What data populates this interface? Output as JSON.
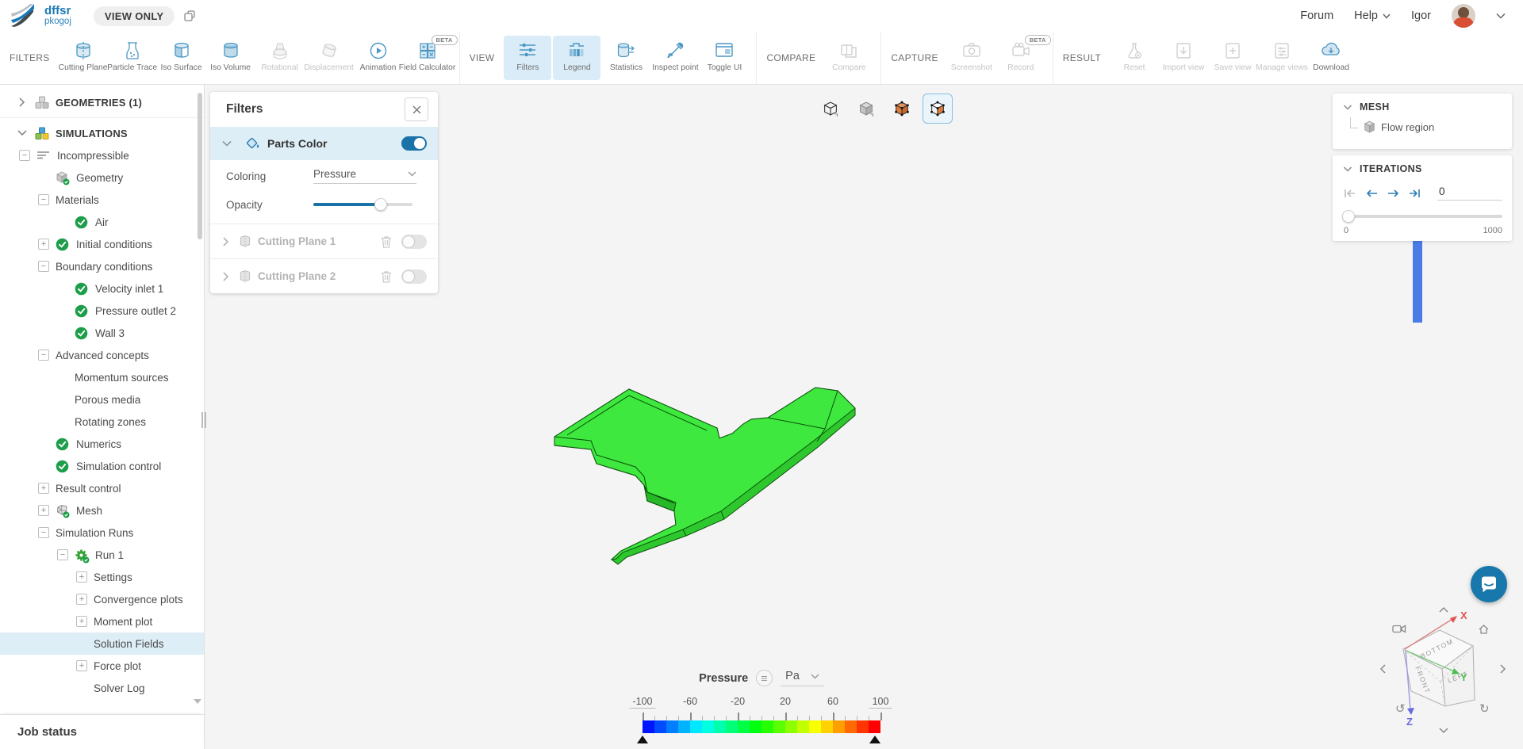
{
  "header": {
    "app_title": "dffsr",
    "app_subtitle": "pkogoj",
    "badge": "VIEW ONLY",
    "forum": "Forum",
    "help": "Help",
    "user": "Igor"
  },
  "toolbar": {
    "sections": [
      {
        "label": "FILTERS",
        "items": [
          {
            "label": "Cutting Plane",
            "icon": "cutting-plane",
            "state": "normal"
          },
          {
            "label": "Particle Trace",
            "icon": "particle-trace",
            "state": "normal"
          },
          {
            "label": "Iso Surface",
            "icon": "iso-surface",
            "state": "normal"
          },
          {
            "label": "Iso Volume",
            "icon": "iso-volume",
            "state": "normal"
          },
          {
            "label": "Rotational",
            "icon": "rotational",
            "state": "disabled"
          },
          {
            "label": "Displacement",
            "icon": "displacement",
            "state": "disabled"
          },
          {
            "label": "Animation",
            "icon": "animation",
            "state": "normal"
          },
          {
            "label": "Field Calculator",
            "icon": "field-calculator",
            "state": "normal",
            "beta": true
          }
        ]
      },
      {
        "label": "VIEW",
        "items": [
          {
            "label": "Filters",
            "icon": "filters",
            "state": "active"
          },
          {
            "label": "Legend",
            "icon": "legend",
            "state": "active"
          },
          {
            "label": "Statistics",
            "icon": "statistics",
            "state": "normal"
          },
          {
            "label": "Inspect point",
            "icon": "inspect-point",
            "state": "normal"
          },
          {
            "label": "Toggle UI",
            "icon": "toggle-ui",
            "state": "normal"
          }
        ]
      },
      {
        "label": "COMPARE",
        "items": [
          {
            "label": "Compare",
            "icon": "compare",
            "state": "disabled"
          }
        ]
      },
      {
        "label": "CAPTURE",
        "items": [
          {
            "label": "Screenshot",
            "icon": "screenshot",
            "state": "disabled"
          },
          {
            "label": "Record",
            "icon": "record",
            "state": "disabled",
            "beta": true
          }
        ]
      },
      {
        "label": "RESULT",
        "items": [
          {
            "label": "Reset",
            "icon": "reset",
            "state": "disabled"
          },
          {
            "label": "Import view",
            "icon": "import-view",
            "state": "disabled"
          },
          {
            "label": "Save view",
            "icon": "save-view",
            "state": "disabled"
          },
          {
            "label": "Manage views",
            "icon": "manage-views",
            "state": "disabled"
          },
          {
            "label": "Download",
            "icon": "download",
            "state": "normal"
          }
        ]
      }
    ]
  },
  "tree": {
    "items": [
      {
        "label": "GEOMETRIES (1)",
        "level": 0,
        "expander": "chevron-right",
        "icon": "cubes-gray",
        "header": true,
        "divider_after": true
      },
      {
        "label": "SIMULATIONS",
        "level": 0,
        "expander": "chevron-down",
        "icon": "cubes-color",
        "header": true
      },
      {
        "label": "Incompressible",
        "level": 1,
        "expander": "minus",
        "icon": "list"
      },
      {
        "label": "Geometry",
        "level": 2,
        "icon": "geometry-check"
      },
      {
        "label": "Materials",
        "level": 2,
        "expander": "minus"
      },
      {
        "label": "Air",
        "level": 3,
        "icon": "check"
      },
      {
        "label": "Initial conditions",
        "level": 2,
        "expander": "plus",
        "icon": "check"
      },
      {
        "label": "Boundary conditions",
        "level": 2,
        "expander": "minus"
      },
      {
        "label": "Velocity inlet 1",
        "level": 3,
        "icon": "check"
      },
      {
        "label": "Pressure outlet 2",
        "level": 3,
        "icon": "check"
      },
      {
        "label": "Wall 3",
        "level": 3,
        "icon": "check"
      },
      {
        "label": "Advanced concepts",
        "level": 2,
        "expander": "minus"
      },
      {
        "label": "Momentum sources",
        "level": 3
      },
      {
        "label": "Porous media",
        "level": 3
      },
      {
        "label": "Rotating zones",
        "level": 3
      },
      {
        "label": "Numerics",
        "level": 2,
        "icon": "check"
      },
      {
        "label": "Simulation control",
        "level": 2,
        "icon": "check"
      },
      {
        "label": "Result control",
        "level": 2,
        "expander": "plus"
      },
      {
        "label": "Mesh",
        "level": 2,
        "expander": "plus",
        "icon": "mesh-check"
      },
      {
        "label": "Simulation Runs",
        "level": 2,
        "expander": "minus"
      },
      {
        "label": "Run 1",
        "level": 3,
        "expander": "minus",
        "icon": "gear-check"
      },
      {
        "label": "Settings",
        "level": 4,
        "expander": "plus"
      },
      {
        "label": "Convergence plots",
        "level": 4,
        "expander": "plus"
      },
      {
        "label": "Moment plot",
        "level": 4,
        "expander": "plus"
      },
      {
        "label": "Solution Fields",
        "level": 4,
        "selected": true
      },
      {
        "label": "Force plot",
        "level": 4,
        "expander": "plus"
      },
      {
        "label": "Solver Log",
        "level": 4
      }
    ],
    "job_status": "Job status"
  },
  "filters_panel": {
    "title": "Filters",
    "parts_color": {
      "label": "Parts Color",
      "enabled": true
    },
    "coloring_label": "Coloring",
    "coloring_value": "Pressure",
    "opacity_label": "Opacity",
    "opacity_percent": 68,
    "cutting_planes": [
      {
        "label": "Cutting Plane 1",
        "enabled": false
      },
      {
        "label": "Cutting Plane 2",
        "enabled": false
      }
    ]
  },
  "view_buttons": [
    {
      "name": "wireframe-cube",
      "selected": false
    },
    {
      "name": "solid-cube",
      "selected": false
    },
    {
      "name": "surfaces-cube",
      "selected": false
    },
    {
      "name": "surfaces-edges-cube",
      "selected": true
    }
  ],
  "right_panel": {
    "mesh": {
      "title": "MESH",
      "item": "Flow region"
    },
    "iterations": {
      "title": "ITERATIONS",
      "value": "0",
      "min": "0",
      "max": "1000"
    }
  },
  "legend": {
    "field": "Pressure",
    "unit": "Pa",
    "ticks": [
      "-100",
      "-60",
      "-20",
      "20",
      "60",
      "100"
    ],
    "cells": [
      "#0015ff",
      "#004aff",
      "#007eff",
      "#00b3ff",
      "#00e8ff",
      "#00ffe2",
      "#00ffad",
      "#00ff79",
      "#00ff44",
      "#00ff10",
      "#25ff00",
      "#5aff00",
      "#8eff00",
      "#c3ff00",
      "#f7ff00",
      "#ffd200",
      "#ff9e00",
      "#ff6900",
      "#ff3500",
      "#ff0000"
    ]
  },
  "nav_cube": {
    "faces": [
      "BOTTOM",
      "FRONT",
      "LEFT"
    ],
    "axes": [
      "X",
      "Y",
      "Z"
    ]
  },
  "colors": {
    "accent": "#2280b5",
    "accent_light": "#d9ecf7",
    "selection": "#ddeef6",
    "model_green": "#3ee83e",
    "model_side_green": "#2ec82e",
    "model_edge": "#0b520b",
    "arrow_blue": "#4b7ce6",
    "check_green": "#1e9e4a",
    "axis_x": "#e05252",
    "axis_y": "#4fbc4f",
    "axis_z": "#6a6ae0"
  }
}
